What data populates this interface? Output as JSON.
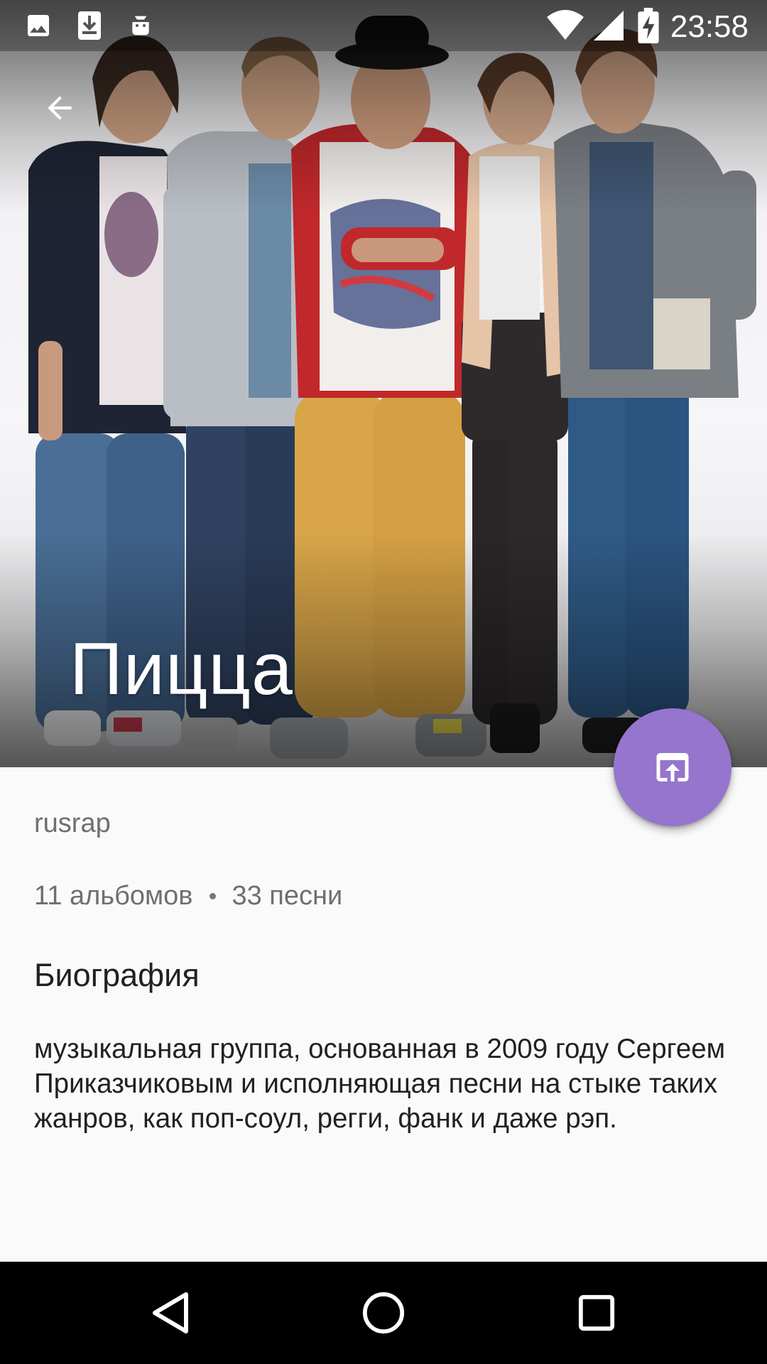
{
  "status_bar": {
    "time": "23:58",
    "icons": [
      "image-notification-icon",
      "download-notification-icon",
      "android-debug-icon",
      "wifi-icon",
      "cell-signal-icon",
      "battery-charging-icon"
    ]
  },
  "artist": {
    "name": "Пицца",
    "genre": "rusrap",
    "albums": "11 альбомов",
    "songs": "33 песни"
  },
  "biography": {
    "title": "Биография",
    "text": "музыкальная группа, основанная в 2009 году Сергеем Приказчиковым и исполняющая песни на стыке таких жанров, как поп-соул, регги, фанк и даже рэп."
  },
  "toolbar": {
    "back_icon": "arrow-back-icon"
  },
  "fab": {
    "icon": "open-in-browser-icon",
    "color": "#9575cd"
  },
  "nav_bar": {
    "icons": [
      "back-triangle-icon",
      "home-circle-icon",
      "recents-square-icon"
    ]
  }
}
